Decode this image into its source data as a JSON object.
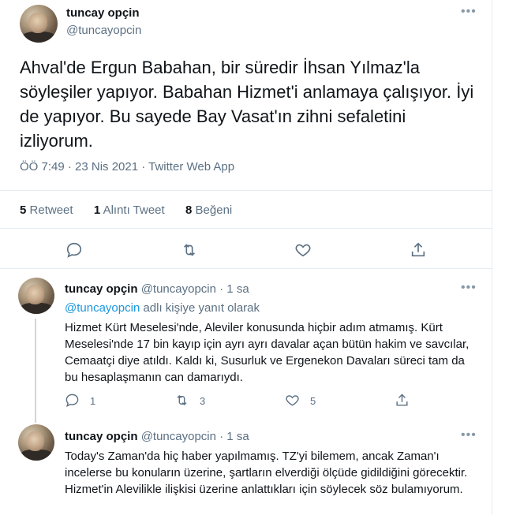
{
  "main_tweet": {
    "name": "tuncay opçin",
    "handle": "@tuncayopcin",
    "text": "Ahval'de Ergun Babahan, bir süredir İhsan Yılmaz'la söyleşiler yapıyor. Babahan Hizmet'i anlamaya çalışıyor. İyi de yapıyor. Bu sayede Bay Vasat'ın zihni sefaletini izliyorum.",
    "timestamp": "ÖÖ 7:49 · 23 Nis 2021 · Twitter Web App",
    "stats": {
      "retweets_count": "5",
      "retweets_label": "Retweet",
      "quotes_count": "1",
      "quotes_label": "Alıntı Tweet",
      "likes_count": "8",
      "likes_label": "Beğeni"
    }
  },
  "replies": [
    {
      "name": "tuncay opçin",
      "handle": "@tuncayopcin",
      "time": "· 1 sa",
      "reply_to_handle": "@tuncayopcin",
      "reply_to_suffix": "adlı kişiye yanıt olarak",
      "text": "Hizmet Kürt Meselesi'nde, Aleviler konusunda hiçbir adım atmamış. Kürt Meselesi'nde 17 bin kayıp için ayrı ayrı davalar açan bütün hakim ve savcılar, Cemaatçi diye atıldı. Kaldı ki, Susurluk ve Ergenekon Davaları süreci tam da bu hesaplaşmanın can damarıydı.",
      "reply_count": "1",
      "retweet_count": "3",
      "like_count": "5"
    },
    {
      "name": "tuncay opçin",
      "handle": "@tuncayopcin",
      "time": "· 1 sa",
      "text": "Today's Zaman'da hiç haber yapılmamış. TZ'yi bilemem, ancak Zaman'ı incelerse bu konuların üzerine, şartların elverdiği ölçüde gidildiğini görecektir. Hizmet'in Alevilikle ilişkisi üzerine anlattıkları için söylecek söz bulamıyorum."
    }
  ],
  "icons": {
    "more": "more-horizontal-icon",
    "reply": "reply-icon",
    "retweet": "retweet-icon",
    "like": "like-icon",
    "share": "share-icon"
  },
  "colors": {
    "link": "#1b95e0",
    "muted": "#5b7083",
    "text": "#0f1419",
    "divider": "#e6ecf0"
  }
}
